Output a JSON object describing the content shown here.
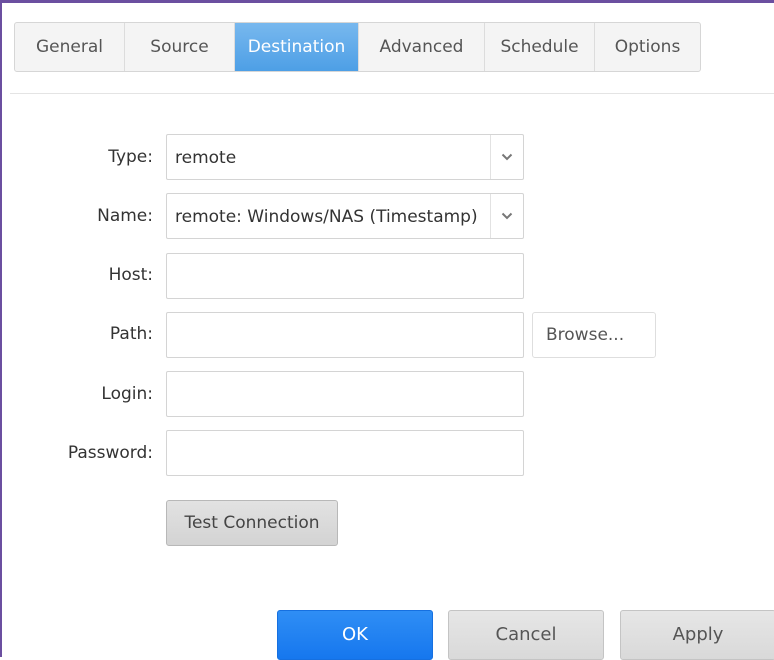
{
  "tabs": [
    {
      "label": "General"
    },
    {
      "label": "Source"
    },
    {
      "label": "Destination"
    },
    {
      "label": "Advanced"
    },
    {
      "label": "Schedule"
    },
    {
      "label": "Options"
    }
  ],
  "active_tab": "Destination",
  "form": {
    "type_label": "Type:",
    "type_value": "remote",
    "name_label": "Name:",
    "name_value": "remote: Windows/NAS (Timestamp)",
    "host_label": "Host:",
    "host_value": "",
    "path_label": "Path:",
    "path_value": "",
    "browse_label": "Browse...",
    "login_label": "Login:",
    "login_value": "",
    "password_label": "Password:",
    "password_value": "",
    "test_connection_label": "Test Connection"
  },
  "footer": {
    "ok_label": "OK",
    "cancel_label": "Cancel",
    "apply_label": "Apply"
  },
  "colors": {
    "accent": "#1677ee",
    "active_tab": "#5ea8ea",
    "frame_border": "#6b4fa0"
  },
  "icons": {
    "dropdown": "chevron-down-icon"
  }
}
